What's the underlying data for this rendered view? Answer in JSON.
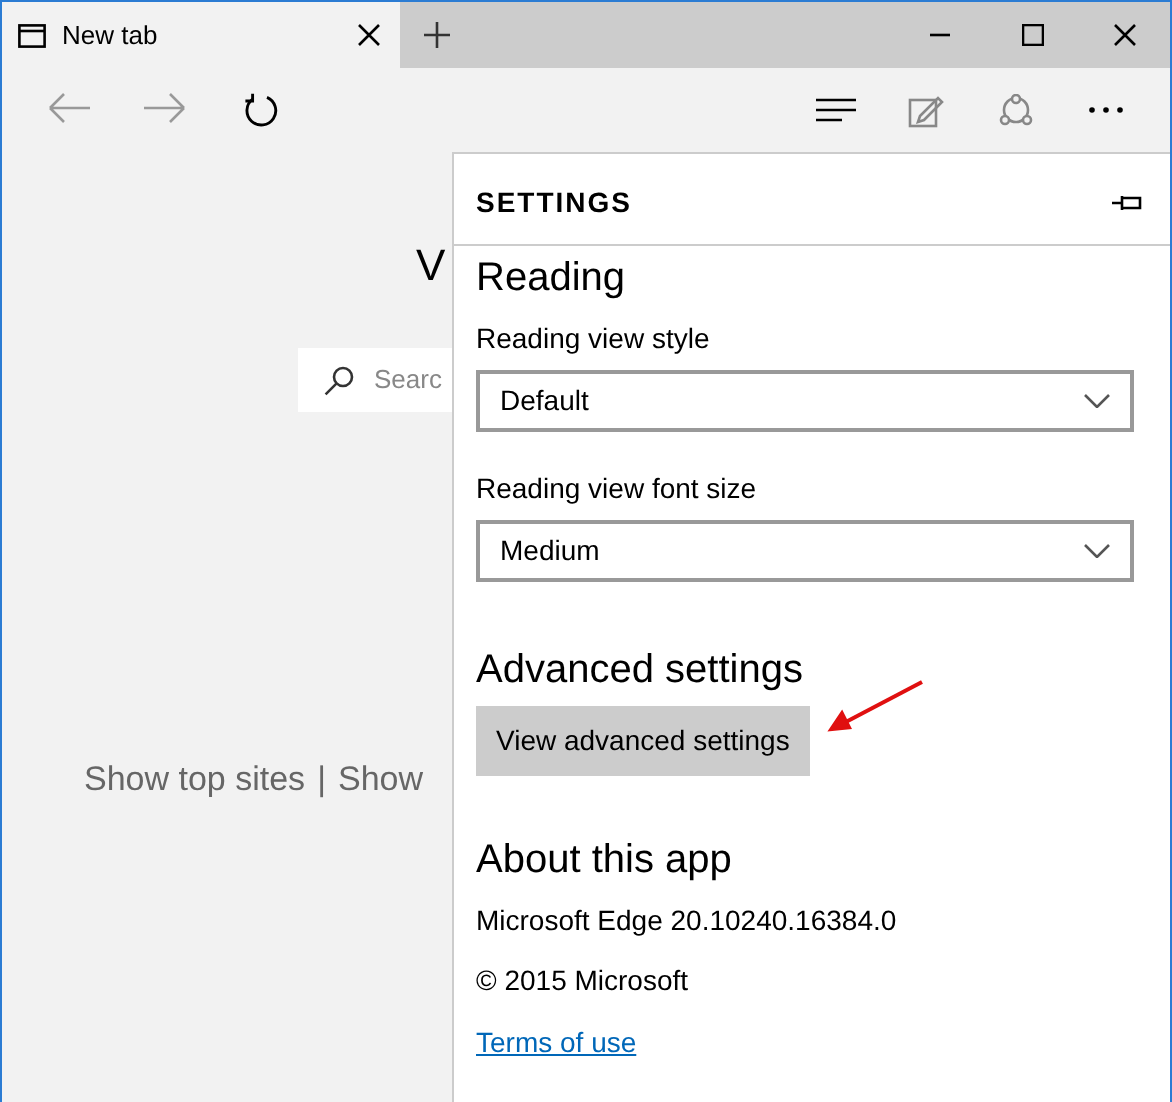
{
  "tabs": [
    {
      "title": "New tab",
      "selected": true
    }
  ],
  "nav_buttons": [
    {
      "kind": "back",
      "disabled": true
    },
    {
      "kind": "forward",
      "disabled": true
    },
    {
      "kind": "refresh",
      "disabled": false
    }
  ],
  "page": {
    "heading": "V",
    "search": {
      "placeholder": "Searc"
    },
    "links": [
      "Show top sites",
      "|",
      "Show"
    ]
  },
  "settings": {
    "title": "SETTINGS",
    "reading": {
      "heading": "Reading",
      "fields": [
        {
          "label": "Reading view style",
          "value": "Default"
        },
        {
          "label": "Reading view font size",
          "value": "Medium"
        }
      ]
    },
    "advanced": {
      "heading": "Advanced settings",
      "button": "View advanced settings"
    },
    "about": {
      "heading": "About this app",
      "lines": [
        "Microsoft Edge 20.10240.16384.0",
        "© 2015 Microsoft"
      ],
      "link": "Terms of use"
    }
  }
}
